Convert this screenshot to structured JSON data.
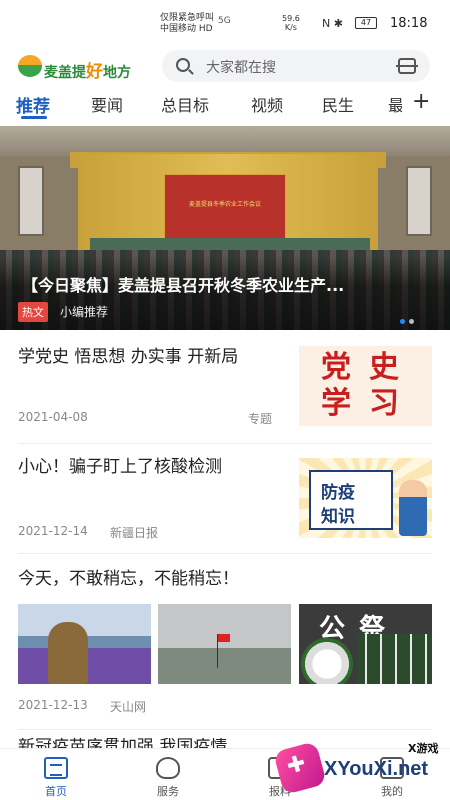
{
  "status_bar": {
    "carrier_line1": "仅限紧急呼叫",
    "carrier_line2": "中国移动 HD",
    "signal": "5G",
    "speed_value": "59.6",
    "speed_unit": "K/s",
    "icons": "N ✱",
    "battery": "47",
    "time": "18:18"
  },
  "header": {
    "logo_text_1": "麦盖提",
    "logo_text_big": "好",
    "logo_text_2": "地方",
    "search_placeholder": "大家都在搜"
  },
  "tabs": {
    "items": [
      "推荐",
      "要闻",
      "总目标",
      "视频",
      "民生",
      "最"
    ],
    "active": "推荐"
  },
  "banner": {
    "screen_text": "麦盖提县冬季农业工作会议",
    "title": "【今日聚焦】麦盖提县召开秋冬季农业生产...",
    "badge": "热文",
    "source": "小编推荐"
  },
  "news": [
    {
      "title": "学党史 悟思想 办实事 开新局",
      "date": "2021-04-08",
      "tag": "专题",
      "thumb_text": [
        "党",
        "史",
        "学",
        "习"
      ]
    },
    {
      "title": "小心！骗子盯上了核酸检测",
      "date": "2021-12-14",
      "source": "新疆日报",
      "thumb_text": [
        "防疫",
        "知识"
      ]
    },
    {
      "title": "今天，不敢稍忘，不能稍忘！",
      "date": "2021-12-13",
      "source": "天山网",
      "thumb_text": "公祭"
    },
    {
      "title": "新冠疫苗序贯加强 我国疫情"
    }
  ],
  "bottom_nav": {
    "items": [
      "首页",
      "服务",
      "报料",
      "我的"
    ],
    "active": "首页"
  },
  "watermark": {
    "brand": "XYouXi.net",
    "small": "X游戏"
  }
}
